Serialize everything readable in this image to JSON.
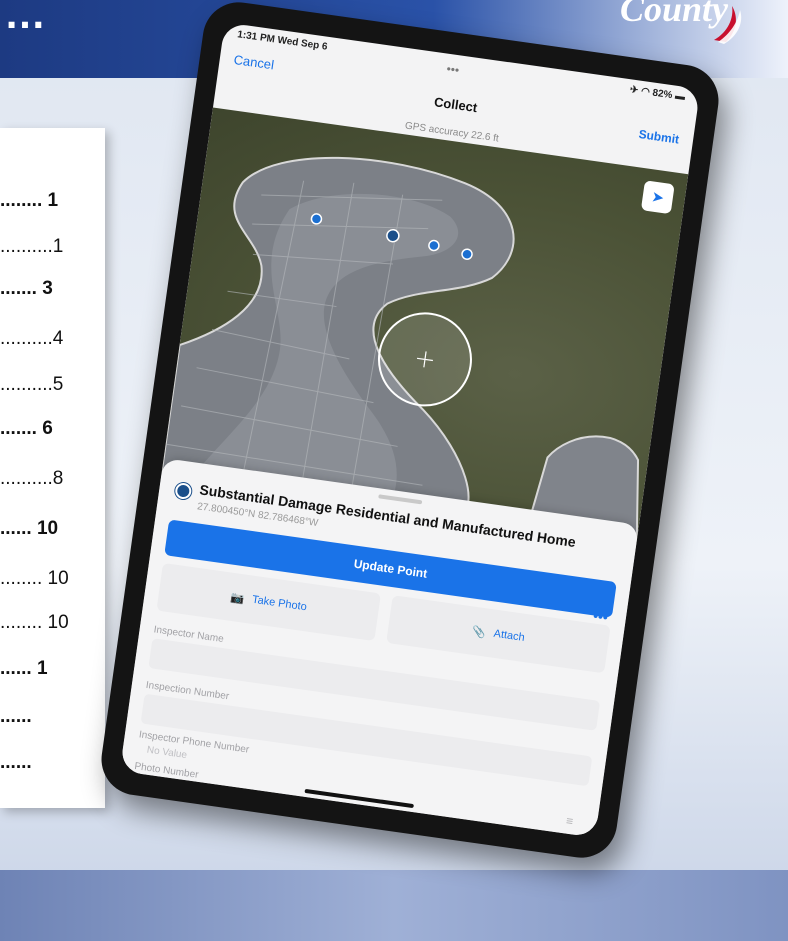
{
  "background": {
    "banner_text": "…",
    "logo_text": "County",
    "toc": [
      {
        "text": "........ 1",
        "bold": true
      },
      {
        "text": "..........1",
        "bold": false
      },
      {
        "text": "....... 3",
        "bold": true
      },
      {
        "text": "..........4",
        "bold": false
      },
      {
        "text": "..........5",
        "bold": false
      },
      {
        "text": "....... 6",
        "bold": true
      },
      {
        "text": "..........8",
        "bold": false
      },
      {
        "text": "...... 10",
        "bold": true
      },
      {
        "text": "........ 10",
        "bold": false
      },
      {
        "text": "........ 10",
        "bold": false
      },
      {
        "text": "...... 1",
        "bold": true
      },
      {
        "text": "......",
        "bold": true
      },
      {
        "text": "......",
        "bold": true
      }
    ]
  },
  "status_bar": {
    "time": "1:31 PM  Wed Sep 6",
    "battery": "82%"
  },
  "nav": {
    "grabber": "•••",
    "cancel": "Cancel",
    "title": "Collect",
    "submit": "Submit",
    "gps_accuracy": "GPS accuracy 22.6 ft"
  },
  "map": {
    "locate_icon": "location-arrow-icon"
  },
  "feature": {
    "title": "Substantial Damage Residential and Manufactured Home",
    "coordinates": "27.800450°N  82.786468°W",
    "more": "•••"
  },
  "actions": {
    "update_point": "Update Point",
    "take_photo": "Take Photo",
    "attach": "Attach"
  },
  "fields": [
    {
      "label": "Inspector Name",
      "value": ""
    },
    {
      "label": "Inspection Number",
      "value": ""
    },
    {
      "label": "Inspector Phone Number",
      "value": "No Value"
    },
    {
      "label": "Photo Number",
      "value": ""
    }
  ],
  "colors": {
    "accent": "#1a73e8",
    "banner": "#1d3a82"
  }
}
